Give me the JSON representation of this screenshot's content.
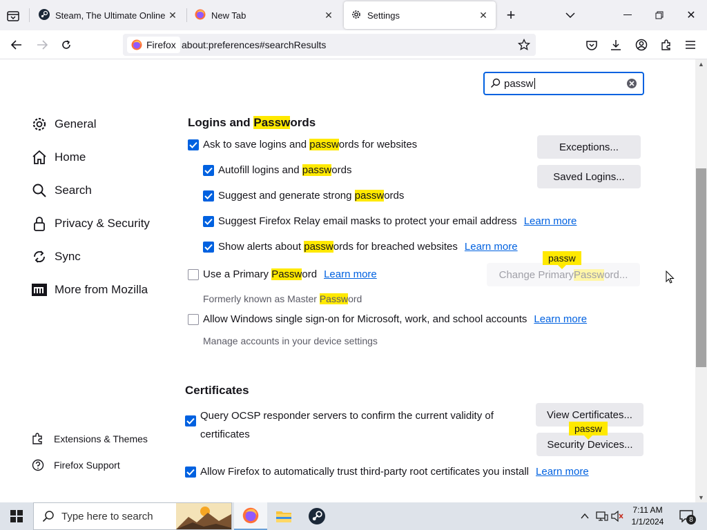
{
  "tabs": [
    {
      "title": "Steam, The Ultimate Online Gar",
      "icon": "steam-icon",
      "active": false
    },
    {
      "title": "New Tab",
      "icon": "firefox-icon",
      "active": false
    },
    {
      "title": "Settings",
      "icon": "gear-icon",
      "active": true
    }
  ],
  "urlbar": {
    "identity_label": "Firefox",
    "url": "about:preferences#searchResults"
  },
  "search": {
    "value": "passw"
  },
  "sidebar": {
    "items": [
      {
        "label": "General",
        "icon": "gear-icon"
      },
      {
        "label": "Home",
        "icon": "home-icon"
      },
      {
        "label": "Search",
        "icon": "search-icon"
      },
      {
        "label": "Privacy & Security",
        "icon": "lock-icon"
      },
      {
        "label": "Sync",
        "icon": "sync-icon"
      },
      {
        "label": "More from Mozilla",
        "icon": "mozilla-icon"
      }
    ],
    "footer": [
      {
        "label": "Extensions & Themes",
        "icon": "puzzle-icon"
      },
      {
        "label": "Firefox Support",
        "icon": "help-icon"
      }
    ]
  },
  "logins": {
    "title_pre": "Logins and ",
    "title_hl": "Passw",
    "title_post": "ords",
    "ask_save": {
      "pre": "Ask to save logins and ",
      "hl": "passw",
      "post": "ords for websites",
      "checked": true
    },
    "autofill": {
      "pre": "Autofill logins and ",
      "hl": "passw",
      "post": "ords",
      "checked": true
    },
    "suggest": {
      "pre": "Suggest and generate strong ",
      "hl": "passw",
      "post": "ords",
      "checked": true
    },
    "relay": {
      "label": "Suggest Firefox Relay email masks to protect your email address",
      "link": "Learn more",
      "checked": true
    },
    "alerts": {
      "pre": "Show alerts about ",
      "hl": "passw",
      "post": "ords for breached websites",
      "link": "Learn more",
      "checked": true
    },
    "primary": {
      "pre": "Use a Primary ",
      "hl": "Passw",
      "post": "ord",
      "link": "Learn more",
      "checked": false
    },
    "primary_note": {
      "pre": "Formerly known as Master ",
      "hl": "Passw",
      "post": "ord"
    },
    "sso": {
      "label": "Allow Windows single sign-on for Microsoft, work, and school accounts",
      "link": "Learn more",
      "checked": false
    },
    "sso_note": "Manage accounts in your device settings",
    "exceptions_button": "Exceptions...",
    "saved_logins_button": "Saved Logins...",
    "change_primary_button": {
      "pre": "Change Primary ",
      "hl": "Passw",
      "post": "ord..."
    },
    "badge": "passw"
  },
  "certificates": {
    "title": "Certificates",
    "ocsp": {
      "line1": "Query OCSP responder servers to confirm the current validity of",
      "line2": "certificates",
      "checked": true
    },
    "trust": {
      "label": "Allow Firefox to automatically trust third-party root certificates you install",
      "link": "Learn more",
      "checked": true
    },
    "view_button": "View Certificates...",
    "security_button": "Security Devices...",
    "badge": "passw"
  },
  "taskbar": {
    "search_placeholder": "Type here to search",
    "time": "7:11 AM",
    "date": "1/1/2024",
    "notification_count": "8"
  },
  "colors": {
    "accent": "#0061e0",
    "highlight": "#ffe900"
  }
}
